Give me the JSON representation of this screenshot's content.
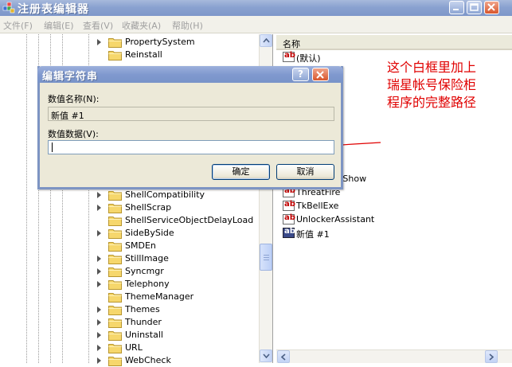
{
  "window": {
    "title": "注册表编辑器"
  },
  "menu": [
    {
      "label": "文件(F)"
    },
    {
      "label": "编辑(E)"
    },
    {
      "label": "查看(V)"
    },
    {
      "label": "收藏夹(A)"
    },
    {
      "label": "帮助(H)"
    }
  ],
  "tree": {
    "items": [
      {
        "label": "PropertySystem",
        "expandable": true
      },
      {
        "label": "Reinstall",
        "expandable": false
      },
      {
        "label": "ShellCompatibility",
        "expandable": true
      },
      {
        "label": "ShellScrap",
        "expandable": true
      },
      {
        "label": "ShellServiceObjectDelayLoad",
        "expandable": false
      },
      {
        "label": "SideBySide",
        "expandable": true
      },
      {
        "label": "SMDEn",
        "expandable": false
      },
      {
        "label": "StillImage",
        "expandable": true
      },
      {
        "label": "Syncmgr",
        "expandable": true
      },
      {
        "label": "Telephony",
        "expandable": true
      },
      {
        "label": "ThemeManager",
        "expandable": false
      },
      {
        "label": "Themes",
        "expandable": true
      },
      {
        "label": "Thunder",
        "expandable": true
      },
      {
        "label": "Uninstall",
        "expandable": true
      },
      {
        "label": "URL",
        "expandable": true
      },
      {
        "label": "WebCheck",
        "expandable": true
      }
    ]
  },
  "values_pane": {
    "column_header": "名称",
    "rows": [
      {
        "label": "(默认)",
        "selected": false
      },
      {
        "label": "n",
        "selected": false
      },
      {
        "label": "c Desktop Show",
        "selected": false
      },
      {
        "label": "ThreatFire",
        "selected": false
      },
      {
        "label": "TkBellExe",
        "selected": false
      },
      {
        "label": "UnlockerAssistant",
        "selected": false
      },
      {
        "label": "新值 #1",
        "selected": true
      }
    ]
  },
  "annotation": {
    "lines": [
      "这个白框里加上",
      "瑞星帐号保险柜",
      "程序的完整路径"
    ],
    "color": "#e00000"
  },
  "dialog": {
    "title": "编辑字符串",
    "help_glyph": "?",
    "name_label": "数值名称(N):",
    "name_value": "新值 #1",
    "data_label": "数值数据(V):",
    "data_value": "",
    "ok_label": "确定",
    "cancel_label": "取消"
  },
  "colors": {
    "title_blue": "#8aa2d0",
    "dialog_bg": "#ece9d8",
    "accent_red": "#e00000"
  }
}
